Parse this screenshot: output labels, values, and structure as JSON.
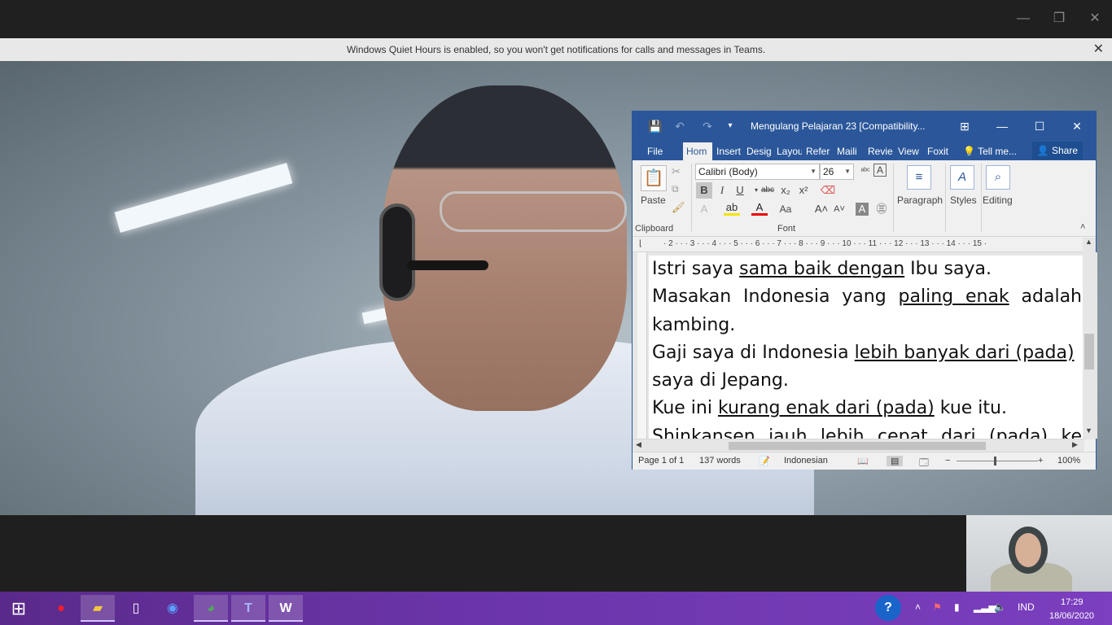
{
  "teams": {
    "banner_text": "Windows Quiet Hours is enabled, so you won't get notifications for calls and messages in Teams.",
    "window_controls": [
      "—",
      "❐",
      "✕"
    ],
    "banner_close": "✕"
  },
  "word": {
    "title": "Mengulang Pelajaran 23 [Compatibility...",
    "qat": {
      "save": "💾",
      "undo": "↶",
      "redo": "↷",
      "customize": "▾"
    },
    "title_icons": {
      "ribbon_display": "⊞",
      "minimize": "—",
      "maximize": "☐",
      "close": "✕"
    },
    "tabs": [
      "File",
      "Hom",
      "Insert",
      "Desig",
      "Layou",
      "Refer",
      "Maili",
      "Revie",
      "View",
      "Foxit"
    ],
    "tell_me": "Tell me...",
    "share": "Share",
    "ribbon": {
      "paste": "Paste",
      "clipboard": "Clipboard",
      "font_name": "Calibri (Body)",
      "font_size": "26",
      "font_group": "Font",
      "paragraph": "Paragraph",
      "styles": "Styles",
      "editing": "Editing",
      "format_buttons": [
        "B",
        "I",
        "U",
        "abc",
        "x₂",
        "x²"
      ]
    },
    "ruler_numbers": "· 2 · · · 3 · · · 4 · · · 5 · · · 6 · · · 7 · · · 8 · · · 9 · · · 10 · · · 11 · · · 12 · · · 13 · · · 14 · · · 15 ·",
    "document": {
      "line1_pre": "Istri saya ",
      "line1_u": "sama baik dengan",
      "line1_post": " Ibu saya.",
      "line2_pre": "Masakan Indonesia yang ",
      "line2_u": "paling enak",
      "line2_post": " adalah",
      "line3": "kambing.",
      "line4_pre": "Gaji saya di Indonesia ",
      "line4_u": "lebih banyak dari (pada)",
      "line5": "saya di Jepang.",
      "line6_pre": "Kue ini ",
      "line6_u": "kurang enak dari (pada)",
      "line6_post": " kue itu.",
      "line7": "Shinkansen jauh lebih cepat dari (pada) ke"
    },
    "status": {
      "page": "Page 1 of 1",
      "words": "137 words",
      "language": "Indonesian",
      "zoom": "100%"
    }
  },
  "taskbar": {
    "language": "IND",
    "time": "17:29",
    "date": "18/06/2020"
  }
}
